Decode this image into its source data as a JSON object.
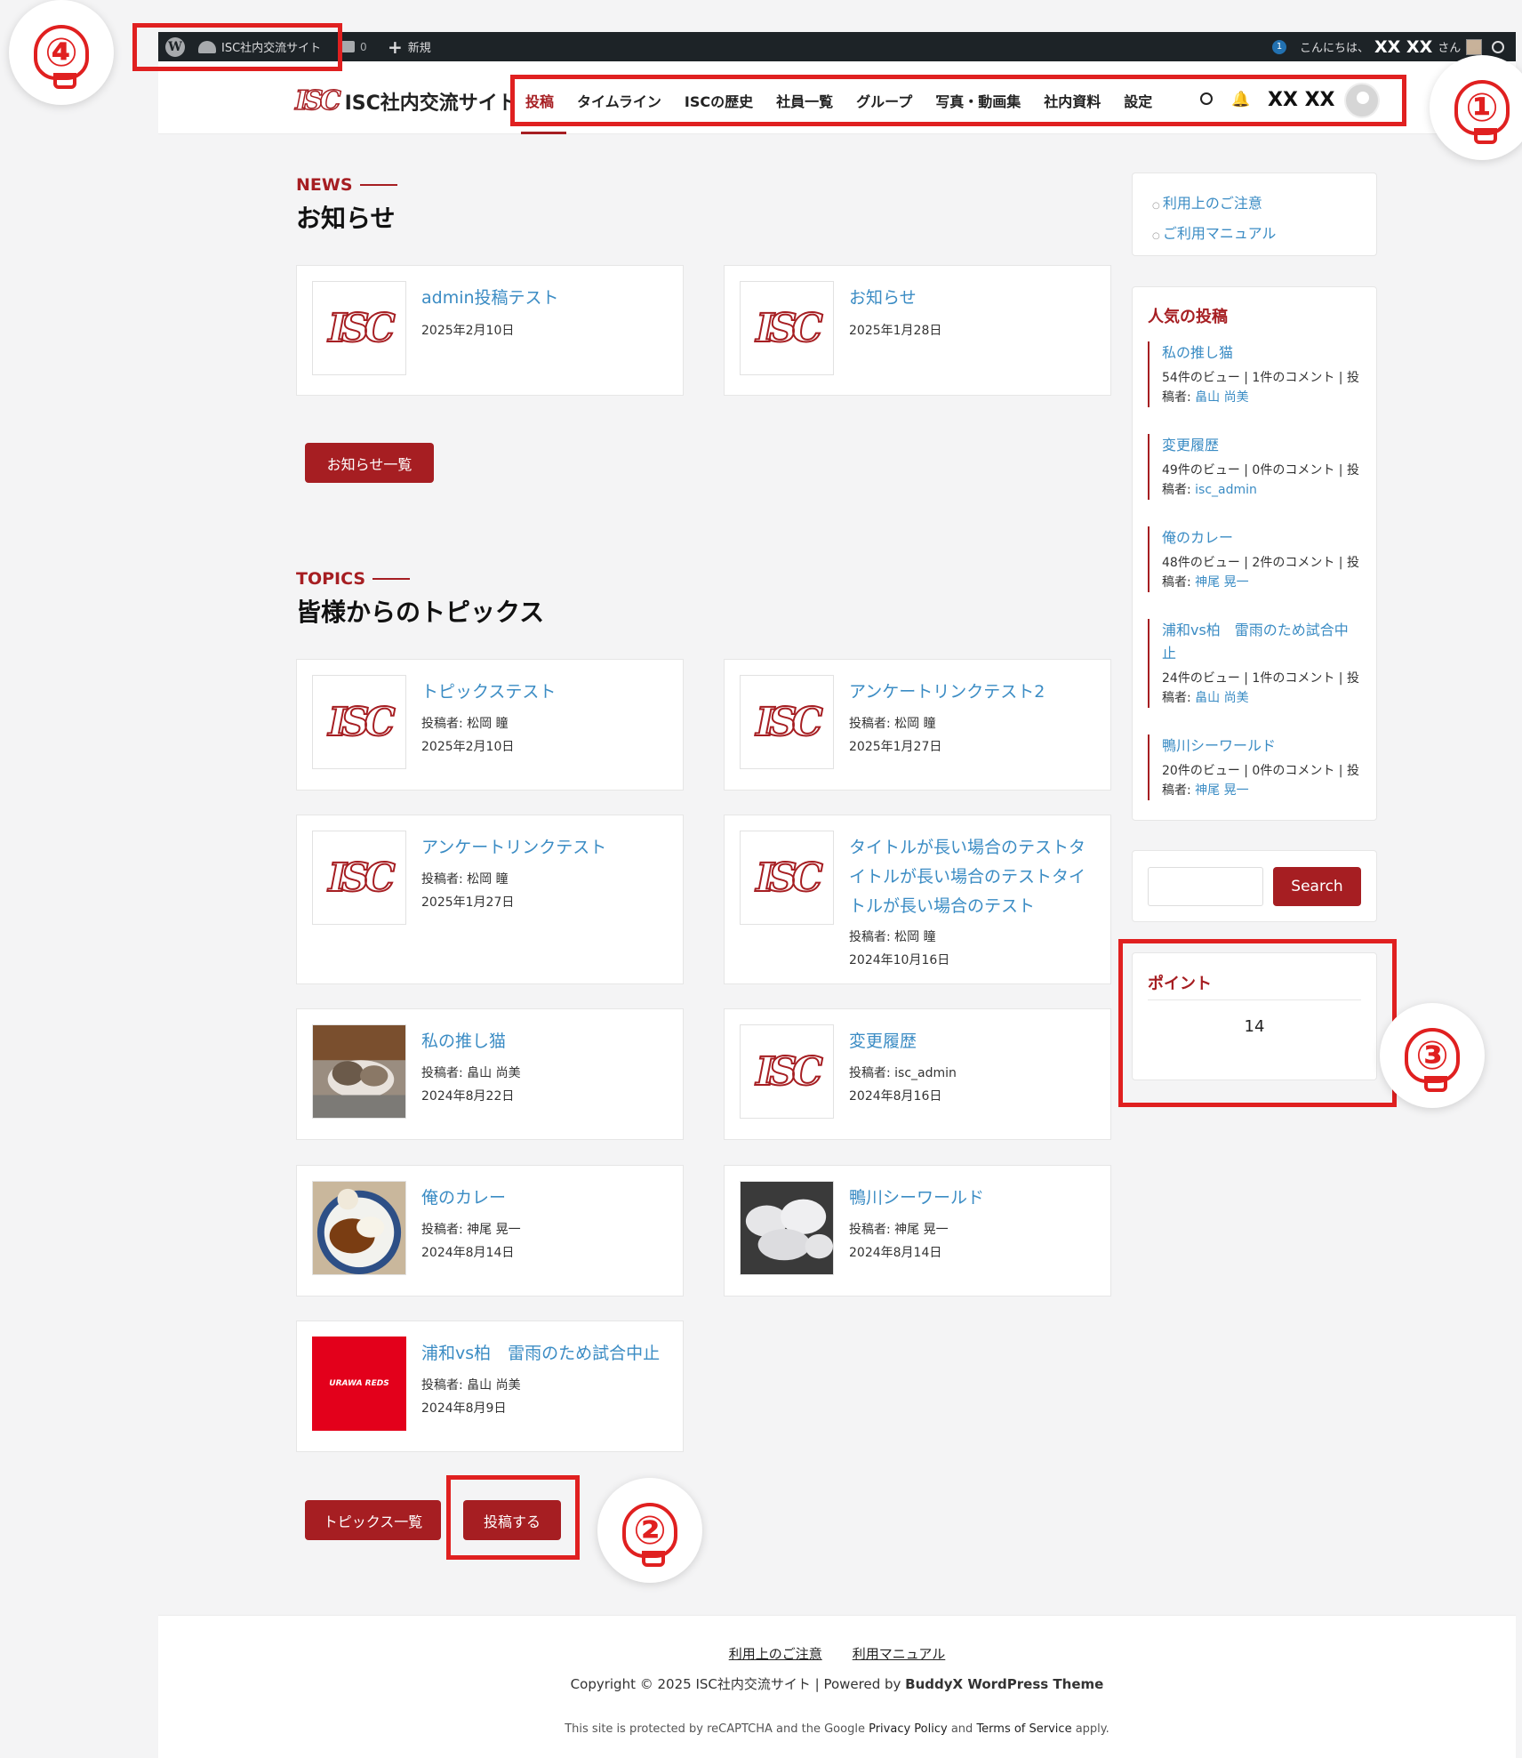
{
  "admin_bar": {
    "site_name": "ISC社内交流サイト",
    "comments_count": "0",
    "new_label": "新規",
    "update_count": "1",
    "greeting": "こんにちは、",
    "user_name": "XX XX",
    "user_suffix": "さん"
  },
  "header": {
    "site_title": "ISC社内交流サイト",
    "logo_text": "ISC",
    "nav": [
      "投稿",
      "タイムライン",
      "ISCの歴史",
      "社員一覧",
      "グループ",
      "写真・動画集",
      "社内資料",
      "設定"
    ],
    "user_name": "XX XX"
  },
  "news": {
    "label": "NEWS",
    "title": "お知らせ",
    "cards": [
      {
        "title": "admin投稿テスト",
        "date": "2025年2月10日"
      },
      {
        "title": "お知らせ",
        "date": "2025年1月28日"
      }
    ],
    "list_button": "お知らせ一覧"
  },
  "topics": {
    "label": "TOPICS",
    "title": "皆様からのトピックス",
    "author_prefix": "投稿者: ",
    "cards": [
      {
        "title": "トピックステスト",
        "author": "松岡 瞳",
        "date": "2025年2月10日"
      },
      {
        "title": "アンケートリンクテスト2",
        "author": "松岡 瞳",
        "date": "2025年1月27日"
      },
      {
        "title": "アンケートリンクテスト",
        "author": "松岡 瞳",
        "date": "2025年1月27日"
      },
      {
        "title": "タイトルが長い場合のテストタイトルが長い場合のテストタイトルが長い場合のテスト",
        "author": "松岡 瞳",
        "date": "2024年10月16日"
      },
      {
        "title": "私の推し猫",
        "author": "畠山 尚美",
        "date": "2024年8月22日"
      },
      {
        "title": "変更履歴",
        "author": "isc_admin",
        "date": "2024年8月16日"
      },
      {
        "title": "俺のカレー",
        "author": "神尾 晃一",
        "date": "2024年8月14日"
      },
      {
        "title": "鴨川シーワールド",
        "author": "神尾 晃一",
        "date": "2024年8月14日"
      },
      {
        "title": "浦和vs柏　雷雨のため試合中止",
        "author": "畠山 尚美",
        "date": "2024年8月9日"
      }
    ],
    "list_button": "トピックス一覧",
    "post_button": "投稿する",
    "urawa_badge": "URAWA REDS"
  },
  "sidebar": {
    "links": [
      "利用上のご注意",
      "ご利用マニュアル"
    ],
    "popular_title": "人気の投稿",
    "popular": [
      {
        "title": "私の推し猫",
        "meta": "54件のビュー | 1件のコメント | 投稿者: ",
        "author": "畠山 尚美"
      },
      {
        "title": "変更履歴",
        "meta": "49件のビュー | 0件のコメント | 投稿者: ",
        "author": "isc_admin"
      },
      {
        "title": "俺のカレー",
        "meta": "48件のビュー | 2件のコメント | 投稿者: ",
        "author": "神尾 晃一"
      },
      {
        "title": "浦和vs柏　雷雨のため試合中止",
        "meta": "24件のビュー | 1件のコメント | 投稿者: ",
        "author": "畠山 尚美"
      },
      {
        "title": "鴨川シーワールド",
        "meta": "20件のビュー | 0件のコメント | 投稿者: ",
        "author": "神尾 晃一"
      }
    ],
    "search_button": "Search",
    "search_placeholder": "",
    "points_title": "ポイント",
    "points_value": "14"
  },
  "annotations": [
    "④",
    "①",
    "③",
    "②"
  ],
  "footer": {
    "links": [
      "利用上のご注意",
      "利用マニュアル"
    ],
    "copyright_prefix": "Copyright © 2025 ISC社内交流サイト | Powered by ",
    "theme": "BuddyX WordPress Theme",
    "recaptcha_prefix": "This site is protected by reCAPTCHA and the Google ",
    "privacy": "Privacy Policy",
    "and": " and ",
    "terms": "Terms of Service",
    "recaptcha_suffix": " apply."
  },
  "colors": {
    "brand": "#a61e22",
    "link": "#3b8cc4",
    "annotation": "#e02020",
    "admin_bar": "#1d2327"
  }
}
